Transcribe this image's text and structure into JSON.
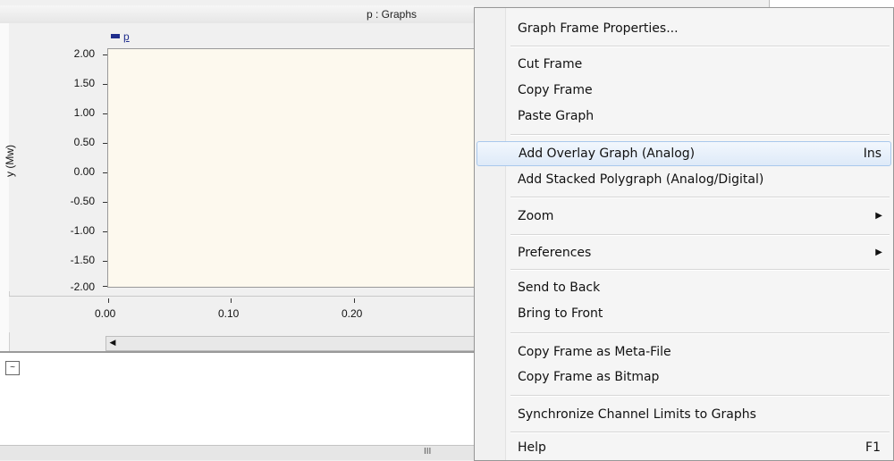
{
  "graph_window": {
    "title": "p : Graphs",
    "legend": "p",
    "y_axis_title": "y (Mw)",
    "y_ticks": [
      "2.00",
      "1.50",
      "1.00",
      "0.50",
      "0.00",
      "-0.50",
      "-1.00",
      "-1.50",
      "-2.00"
    ],
    "x_ticks": [
      "0.00",
      "0.10",
      "0.20"
    ],
    "scroll_left_arrow": "◀",
    "scroll_grip": "III"
  },
  "context_menu": {
    "items": [
      {
        "label": "Graph Frame Properties..."
      },
      {
        "label": "Cut Frame"
      },
      {
        "label": "Copy Frame"
      },
      {
        "label": "Paste Graph"
      },
      {
        "label": "Add Overlay Graph (Analog)",
        "shortcut": "Ins",
        "highlighted": true
      },
      {
        "label": "Add Stacked Polygraph (Analog/Digital)"
      },
      {
        "label": "Zoom",
        "submenu": true
      },
      {
        "label": "Preferences",
        "submenu": true
      },
      {
        "label": "Send to Back"
      },
      {
        "label": "Bring to Front"
      },
      {
        "label": "Copy Frame as Meta-File"
      },
      {
        "label": "Copy Frame as Bitmap"
      },
      {
        "label": "Synchronize Channel Limits to Graphs"
      },
      {
        "label": "Help",
        "shortcut": "F1"
      }
    ],
    "submenu_arrow": "▶"
  }
}
